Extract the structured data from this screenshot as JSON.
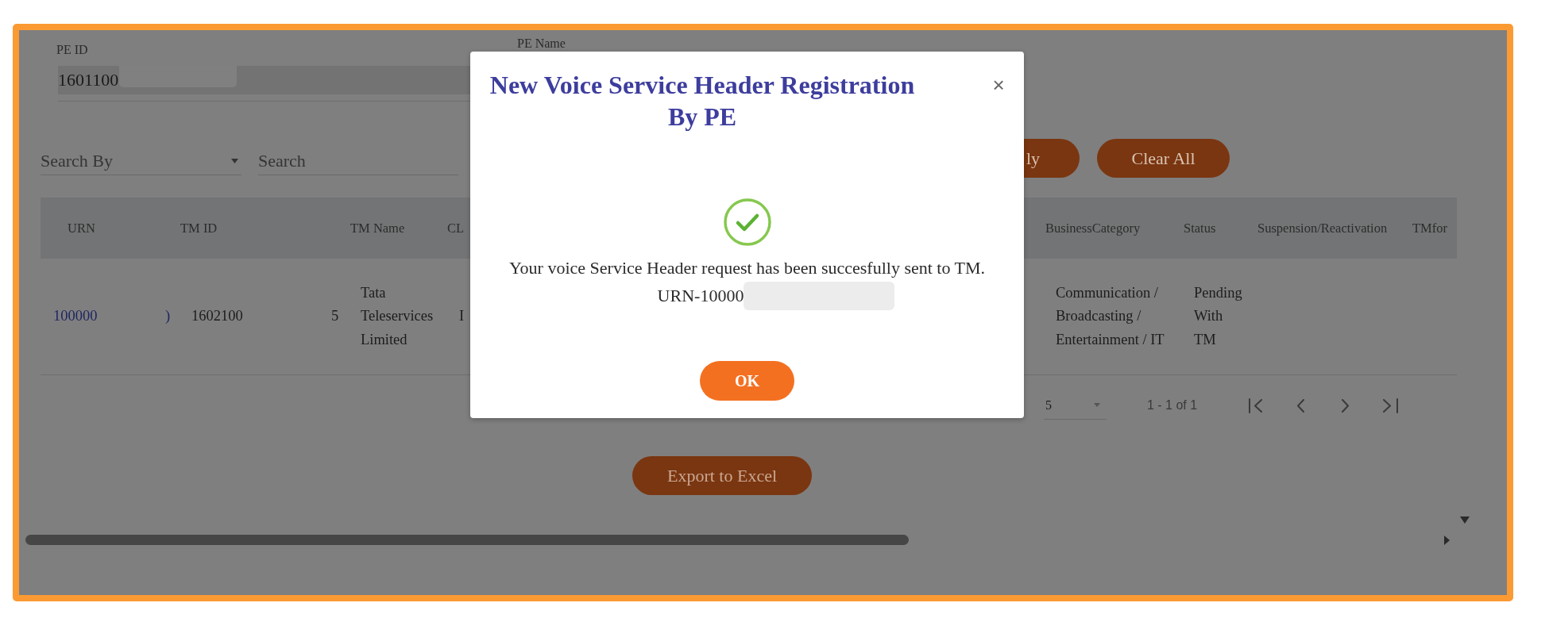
{
  "pe_id": {
    "label": "PE ID",
    "value": "1601100"
  },
  "pe_name": {
    "label": "PE Name"
  },
  "search": {
    "search_by": {
      "placeholder": "Search By"
    },
    "search_field": {
      "placeholder": "Search"
    },
    "buttons": [
      {
        "label": "ly"
      },
      {
        "label": "Clear All"
      }
    ]
  },
  "table": {
    "columns": [
      "URN",
      "TM ID",
      "TM Name",
      "CL",
      "BusinessCategory",
      "Status",
      "Suspension/Reactivation",
      "TMfor"
    ],
    "rows": [
      {
        "cells": [
          {
            "kind": "link",
            "parts": [
              "100000",
              ")"
            ]
          },
          {
            "kind": "text",
            "parts": [
              "1602100",
              "5"
            ]
          },
          {
            "kind": "text",
            "parts": [
              "Tata Teleservices Limited"
            ]
          },
          {
            "kind": "text",
            "parts": [
              "I"
            ]
          },
          {
            "kind": "text",
            "parts": [
              "Communication / Broadcasting / Entertainment / IT"
            ]
          },
          {
            "kind": "text",
            "parts": [
              "Pending With TM"
            ]
          }
        ]
      }
    ]
  },
  "paginator": {
    "page_size": "5",
    "range": "1 - 1 of 1"
  },
  "export_button": {
    "label": "Export to Excel"
  },
  "dialog": {
    "title": "New Voice Service Header Registration By PE",
    "close": "×",
    "message": "Your voice Service Header request has been succesfully sent to TM.",
    "reference": "URN-10000",
    "button": "OK"
  }
}
